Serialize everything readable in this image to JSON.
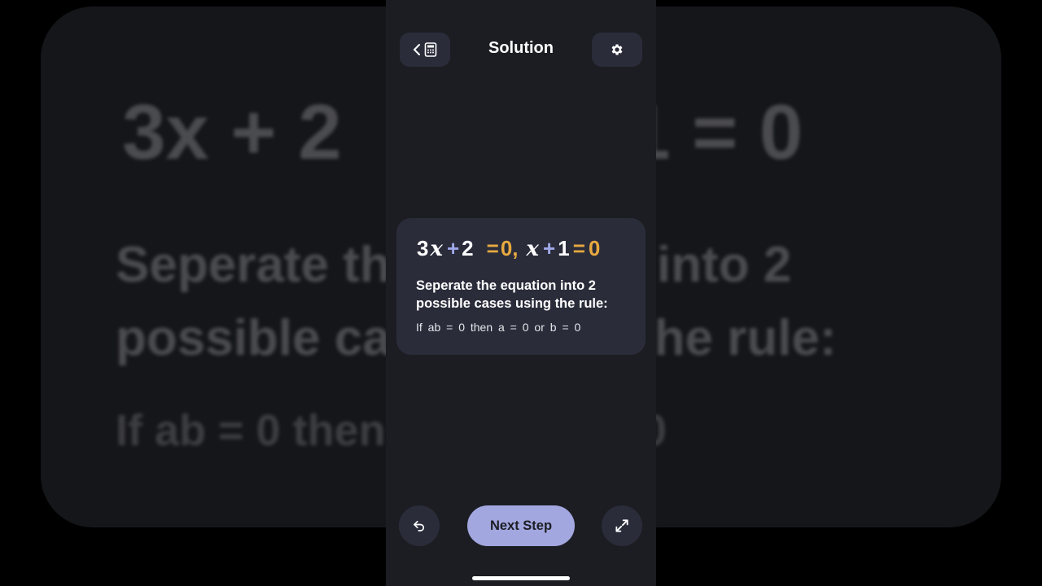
{
  "header": {
    "title": "Solution",
    "back_icon": "chevron-left-icon",
    "calculator_icon": "calculator-icon",
    "settings_icon": "gear-icon"
  },
  "card": {
    "equation": {
      "part1_coef": "3",
      "part1_var": "x",
      "plus1": "+",
      "part1_const": "2",
      "eq1": "=",
      "zero1": "0",
      "comma": ",",
      "part2_var": "x",
      "plus2": "+",
      "part2_const": "1",
      "eq2": "=",
      "zero2": "0"
    },
    "description": "Seperate the equation into 2 possible cases using the rule:",
    "rule": "If  ab = 0  then  a = 0  or  b = 0"
  },
  "footer": {
    "undo_icon": "undo-icon",
    "next_label": "Next Step",
    "expand_icon": "expand-icon"
  },
  "background": {
    "equation_left": "3x + 2",
    "equation_right": "1 = 0",
    "line1": "Seperate the equation into 2",
    "line2": "possible cases using the rule:",
    "line3": "If  ab = 0  then  a = 0  or  b = 0"
  },
  "colors": {
    "accent": "#a2a7e0",
    "answer": "#e8a940",
    "operator": "#9ea8e8",
    "card_bg": "#2a2c3a"
  }
}
